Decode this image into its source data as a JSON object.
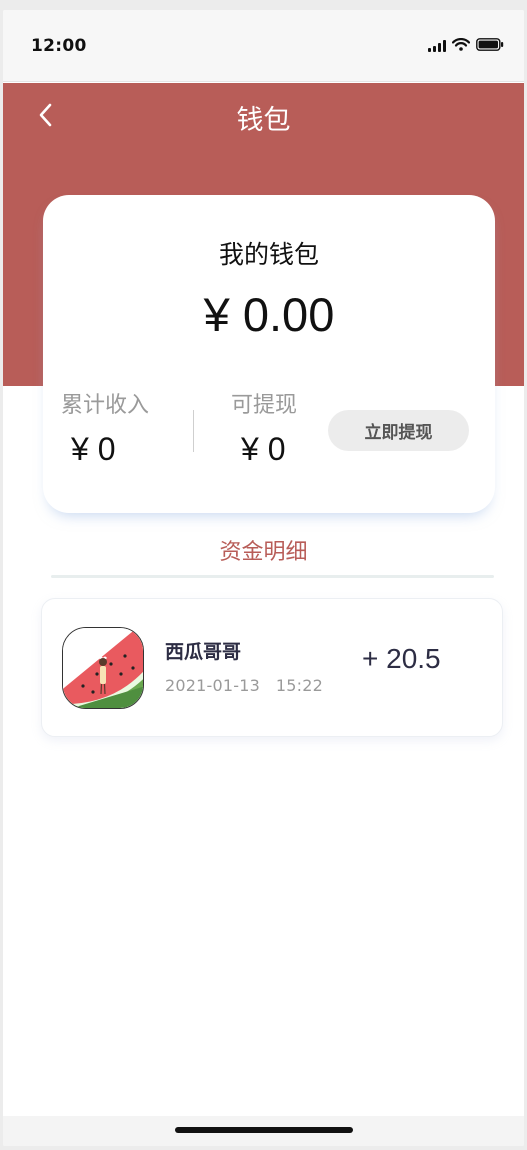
{
  "status_bar": {
    "time": "12:00",
    "icons": [
      "signal-icon",
      "wifi-icon",
      "battery-icon"
    ]
  },
  "nav": {
    "title": "钱包",
    "back_icon": "chevron-left-icon"
  },
  "wallet": {
    "title": "我的钱包",
    "balance": "¥ 0.00",
    "total_income_label": "累计收入",
    "total_income_value": "¥ 0",
    "withdrawable_label": "可提现",
    "withdrawable_value": "¥ 0",
    "withdraw_button": "立即提现"
  },
  "details": {
    "section_title": "资金明细",
    "records": [
      {
        "name": "西瓜哥哥",
        "date": "2021-01-13",
        "time": "15:22",
        "amount": "+ 20.5",
        "avatar": "watermelon-avatar"
      }
    ]
  },
  "colors": {
    "accent": "#b85d58",
    "text_dark": "#2d2d44",
    "muted": "#9a9a9a",
    "button_bg": "#ececec"
  }
}
